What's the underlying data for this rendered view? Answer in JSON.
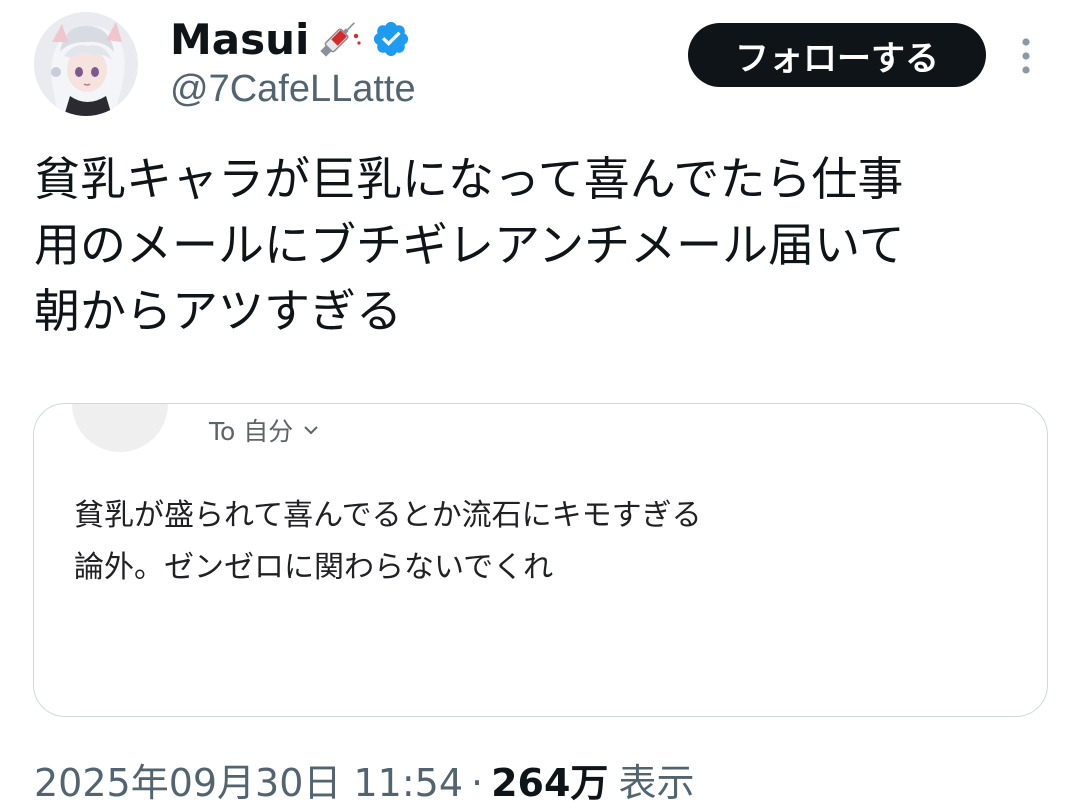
{
  "author": {
    "display_name": "Masui",
    "name_emoji_icon": "syringe-icon",
    "verified_icon": "verified-badge-icon",
    "handle": "@7CafeLLatte",
    "avatar_icon": "anime-avatar"
  },
  "actions": {
    "follow_label": "フォローする",
    "more_icon": "more-vertical-icon"
  },
  "tweet": {
    "text_lines": [
      "貧乳キャラが巨乳になって喜んでたら仕事",
      "用のメールにブチギレアンチメール届いて",
      "朝からアツすぎる"
    ]
  },
  "attached_image": {
    "recipient_label": "To 自分",
    "chevron_icon": "chevron-down-icon",
    "body_lines": [
      "貧乳が盛られて喜んでるとか流石にキモすぎる",
      "論外。ゼンゼロに関わらないでくれ"
    ]
  },
  "meta": {
    "timestamp": "2025年09月30日 11:54",
    "separator": "·",
    "views_count": "264万",
    "views_label": "表示"
  },
  "colors": {
    "text_primary": "#0f1419",
    "text_secondary": "#536471",
    "verified_blue": "#1d9bf0",
    "follow_button_bg": "#0f1419",
    "card_border": "#cfd9de"
  }
}
